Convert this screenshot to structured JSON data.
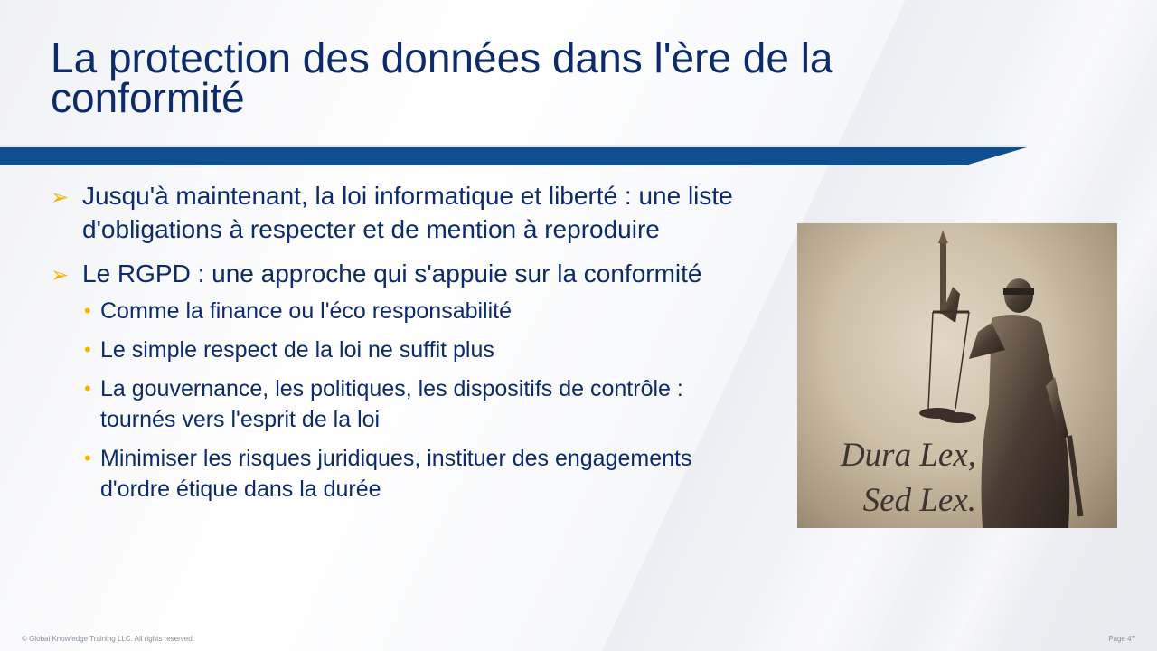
{
  "slide": {
    "title_line1": "La protection des données dans l'ère de la",
    "title_line2": "conformité"
  },
  "bullets": [
    {
      "text": "Jusqu'à maintenant, la loi informatique et liberté : une liste d'obligations à respecter et de mention à reproduire",
      "sub": []
    },
    {
      "text": "Le RGPD : une approche qui s'appuie sur la conformité",
      "sub": [
        "Comme la finance ou l'éco responsabilité",
        "Le simple respect de la loi ne suffit plus",
        "La gouvernance, les politiques, les dispositifs de contrôle : tournés vers l'esprit de la loi",
        "Minimiser les risques juridiques, instituer des engagements d'ordre étique dans la durée"
      ]
    }
  ],
  "image": {
    "caption_line1": "Dura Lex,",
    "caption_line2": "Sed Lex.",
    "subject": "lady-justice-statue"
  },
  "footer": {
    "copyright": "© Global Knowledge Training LLC. All rights reserved.",
    "page": "Page 47"
  },
  "colors": {
    "title": "#0d2a6b",
    "bar": "#0d4f8f",
    "bullet_accent": "#f4b400"
  }
}
